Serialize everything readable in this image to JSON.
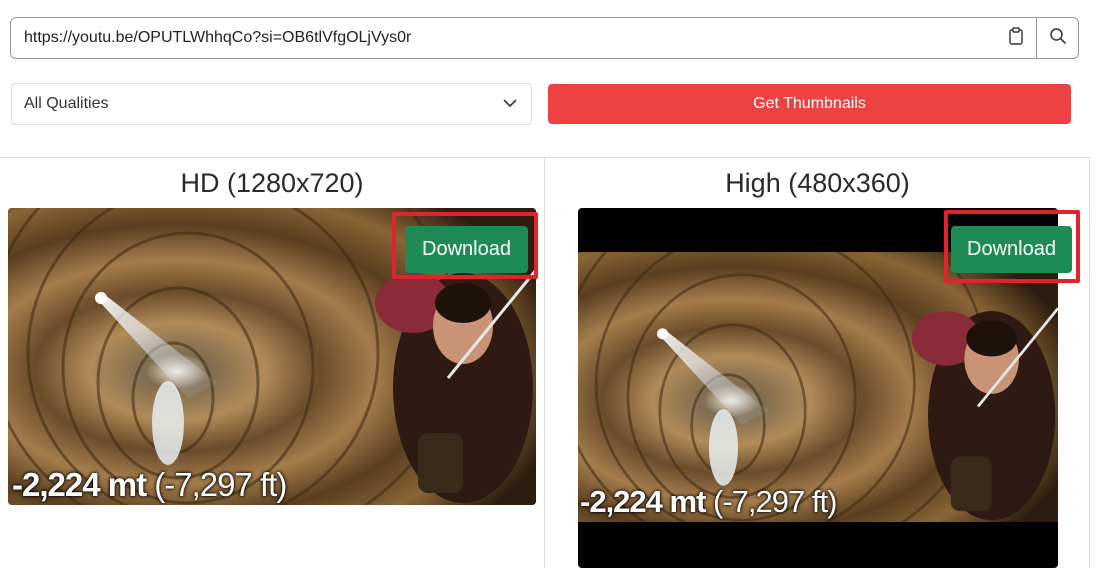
{
  "search": {
    "url_value": "https://youtu.be/OPUTLWhhqCo?si=OB6tlVfgOLjVys0r",
    "paste_icon": "clipboard-icon",
    "search_icon": "search-icon"
  },
  "quality": {
    "selected": "All Qualities",
    "chevron_icon": "chevron-down-icon"
  },
  "actions": {
    "get_thumbnails_label": "Get Thumbnails",
    "accent_color": "#ee4242",
    "download_color": "#1e8a54",
    "highlight_color": "#e2232d"
  },
  "results": [
    {
      "title": "HD (1280x720)",
      "download_label": "Download",
      "caption_depth": "-2,224 mt",
      "caption_feet": "(-7,297 ft)"
    },
    {
      "title": "High (480x360)",
      "download_label": "Download",
      "caption_depth": "-2,224 mt",
      "caption_feet": "(-7,297 ft)"
    }
  ]
}
